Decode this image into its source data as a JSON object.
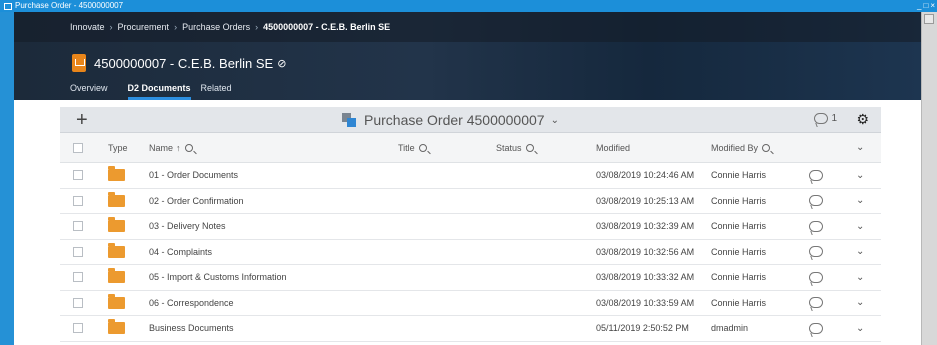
{
  "window": {
    "title": "Purchase Order - 4500000007",
    "controls": [
      "_",
      "□",
      "×"
    ]
  },
  "breadcrumb": {
    "items": [
      "Innovate",
      "Procurement",
      "Purchase Orders"
    ],
    "current": "4500000007 - C.E.B. Berlin SE"
  },
  "object": {
    "title": "4500000007 - C.E.B. Berlin SE",
    "link_glyph": "⊘"
  },
  "tabs": [
    {
      "label": "Overview",
      "active": false
    },
    {
      "label": "D2 Documents",
      "active": true
    },
    {
      "label": "Related",
      "active": false
    }
  ],
  "toolbar": {
    "add_glyph": "+",
    "title": "Purchase Order 4500000007",
    "dropdown_glyph": "⌄",
    "comment_count": "1",
    "settings_glyph": "⚙"
  },
  "columns": {
    "type": "Type",
    "name": "Name",
    "sort_glyph": "↑",
    "title": "Title",
    "status": "Status",
    "modified": "Modified",
    "modified_by": "Modified By",
    "expand_glyph": "⌄"
  },
  "rows": [
    {
      "name": "01 - Order Documents",
      "modified": "03/08/2019 10:24:46 AM",
      "modified_by": "Connie Harris"
    },
    {
      "name": "02 - Order Confirmation",
      "modified": "03/08/2019 10:25:13 AM",
      "modified_by": "Connie Harris"
    },
    {
      "name": "03 - Delivery Notes",
      "modified": "03/08/2019 10:32:39 AM",
      "modified_by": "Connie Harris"
    },
    {
      "name": "04 - Complaints",
      "modified": "03/08/2019 10:32:56 AM",
      "modified_by": "Connie Harris"
    },
    {
      "name": "05 - Import & Customs Information",
      "modified": "03/08/2019 10:33:32 AM",
      "modified_by": "Connie Harris"
    },
    {
      "name": "06 - Correspondence",
      "modified": "03/08/2019 10:33:59 AM",
      "modified_by": "Connie Harris"
    },
    {
      "name": "Business Documents",
      "modified": "05/11/2019 2:50:52 PM",
      "modified_by": "dmadmin"
    }
  ],
  "row_expand_glyph": "⌄",
  "colors": {
    "window_bar": "#1c8fd9",
    "header_dark": "#1c2a3a",
    "tab_underline": "#2d8fe0",
    "folder": "#ec9a2f",
    "object_icon": "#e8851a"
  }
}
